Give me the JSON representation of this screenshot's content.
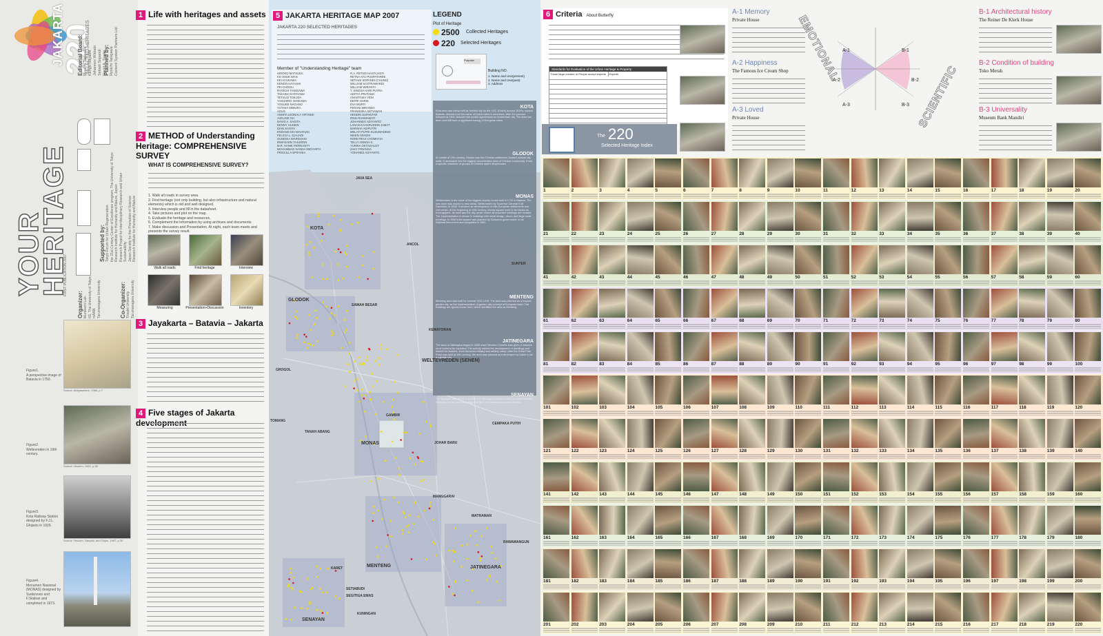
{
  "branding": {
    "jakarta": "JAKARTA",
    "number": "220",
    "selected": "SELECTED HERITAGES",
    "your": "YOUR",
    "heritage": "HERITAGE",
    "first_pub": "FIRST PUBLICATION 2007",
    "editorial_title": "Editorial Board:",
    "editorial_names": [
      "Ryoichi Tanigawa",
      "Kengo Hayashi",
      "Johannes Widodo",
      "Setiadi Sopandi",
      "David A. Sagita"
    ],
    "planned_title": "Planned by:",
    "planned_names": [
      "Ryoichi Tanigawa",
      "Content System Partners Ltd."
    ],
    "supported_title": "Supported by:",
    "supported_lines": [
      "Tokyo Forum for Urban Regeneration",
      "the 21st Century Center of Excellence program, The University of Tokyo",
      "Research Institute for Humanity and Nature, Japan",
      "Research Project for Interdisciplinary Research and Urban Sustainability",
      "Japan Society for the Promotion of Science",
      "Research Institute for Humanity and Nature"
    ],
    "organizer_title": "Organizer:",
    "organizer_lines": [
      "Murakami Lab.",
      "IIS, The University of Tokyo",
      "mAAN",
      "Tarumanagara University"
    ],
    "coorganizer_title": "Co-Organizer:",
    "coorganizer_lines": [
      "Trisakti University",
      "Tarumanagara University"
    ]
  },
  "figures": [
    {
      "label": "Figure1.",
      "caption": "A perspective image of Batavia in 1750.",
      "source": "Source: Abeyasekere, 1989, p.7"
    },
    {
      "label": "Figure2.",
      "caption": "Weltevreden in 19th century.",
      "source": "Source: Heuken, 1982, p.38"
    },
    {
      "label": "Figure3.",
      "caption": "Kota Railway Station designed by F.J.L. Ghijsels in 1929.",
      "source": "Source: Heuken, Haryadi, and Grijns, 1997, p.34"
    },
    {
      "label": "Figure4.",
      "caption": "Monumen Nasional (MONAS) designed by Sudarsono and F.Silaban and completed in 1973.",
      "source": ""
    }
  ],
  "sections": {
    "s1": {
      "num": "1",
      "title": "Life with heritages and assets"
    },
    "s2": {
      "num": "2",
      "title": "METHOD of Understanding Heritage: COMPREHENSIVE SURVEY",
      "subtitle": "WHAT IS COMPREHENSIVE SURVEY?"
    },
    "s3": {
      "num": "3",
      "title": "Jayakarta – Batavia – Jakarta"
    },
    "s4": {
      "num": "4",
      "title": "Five stages of Jakarta development"
    },
    "s5": {
      "num": "5",
      "title": "JAKARTA HERITAGE MAP 2007",
      "subtitle": "JAKARTA 220 SELECTED HERITAGES",
      "members_title": "Member of \"Understanding Heritage\" team"
    },
    "s6": {
      "num": "6",
      "title": "Criteria",
      "subtitle": "About Butterfly"
    }
  },
  "survey_steps": [
    "1. Walk all roads in survey area.",
    "2. Find heritage (not only building, but also infrastructure and natural elements) which is old and well designed.",
    "3. Interview people and fill in the datasheet.",
    "4. Take pictures and plot on the map.",
    "5. Evaluate the heritage and resources.",
    "6. Complement the information by using archives and documents.",
    "7. Make discussion and Presentation. At night, each team meets and presents the survey result."
  ],
  "survey_photos": [
    "Walk all roads",
    "Find heritage",
    "Interview",
    "Measuring",
    "Presentation+Discussion",
    "Inventory"
  ],
  "members_left": [
    "HIROKO MATSUDA",
    "KO SHUK WAN",
    "KEI AYUKAWA",
    "KENGO HAYASHI",
    "PEI CHOOLI",
    "RYOICHI TANIGAWA",
    "TAKASHI KATAYAMA",
    "TETSUJI TOKUDA",
    "YASUHIRO ISHIKAWA",
    "YOSUKE NAGANO",
    "YUTAKA MIMURA",
    "AGUS",
    "ANNITA LEONALY AFFANDI",
    "AVELINE OH",
    "DAVID A. SAGITA",
    "DENNY HUSEIN",
    "DIAN SAGITA",
    "ENDANG EKI WAHYUNI",
    "FELICIA L. DJAJADI",
    "GUNDIKA WARDHANI",
    "IRWAN BIN TAJUDDIN",
    "M.R. HANIK FERRIANTY",
    "MOHAMMAD NANDA WIDYARTA",
    "PRISCILLA EPIFANIA"
  ],
  "members_right": [
    "R.A. RETNO HASTIJANTI",
    "RETNA AYU PUSPATARINI",
    "SETIADI SOPANDI (CHUNG)",
    "WILLIAM SASTRAWARDI",
    "WILLIAM WIRANTA",
    "Y. KINGSA HARI PUTRA",
    "ADITYA PRATAMA",
    "ANASTASIA YENI",
    "DEFRI HARIS",
    "EVA MURTI",
    "FERANI MIRANDA",
    "FRANSISKA SETIAWAN",
    "HENDRI SUPANTAR",
    "IRMA RAHMAWATI",
    "JOHANNES ADIYANTO",
    "LANAN KAHARUDDIN JAMAT",
    "MARSHA ADIPUTRI",
    "MELATI PUTRI KUSUMADEWI",
    "NIKEN ARADHI",
    "RORETRAS CHOMIYAH",
    "TELLY ANNISA K.",
    "YURIKA OKTAVIALDY",
    "ZAKY PRIANGA",
    "YOHANES ADIYANTO"
  ],
  "legend": {
    "title": "LEGEND",
    "plot": "Plot of Heritage",
    "collected_num": "2500",
    "collected_label": "Collected Heritages",
    "selected_num": "220",
    "selected_label": "Selected Heritages",
    "yellow": "#f5d90a",
    "red": "#d7191c",
    "building_no": "Building NO.",
    "building_items": [
      "1. Name and Use(present)",
      "2. Name and Use(past)",
      "3. Address"
    ],
    "label_purpose": "Purpose"
  },
  "map_labels": [
    "JAVA SEA",
    "KOTA",
    "GLODOK",
    "ANCOL",
    "SUNTER",
    "SAWAH BESAR",
    "KEMAYORAN",
    "WELTEVREDEN (SENEN)",
    "MONAS",
    "TANAH ABANG",
    "CEMPAKA PUTIH",
    "TOMANG",
    "JOHAR BARU",
    "GROGOL",
    "MATRAMAN",
    "RAWAMANGUN",
    "MENTENG",
    "KARET",
    "SETIABUDI",
    "SENAYAN",
    "JATINEGARA",
    "SEGITIGA EMAS",
    "KUNINGAN",
    "MANGGARAI",
    "GAMBIR"
  ],
  "districts": [
    {
      "name": "KOTA",
      "text": "Kota area was being built as fortified city by the VOC (Dutch) around 1619's, named Batavia, derived from the name of Dutch nation's ancestors. After the process followed at 1808, Batavia had similar appearance as Amsterdam city. The area has been and still have a significant energy of European cities."
    },
    {
      "name": "GLODOK",
      "text": "At middle of 17th century, Glodok was the Chinese settlement, located outside city walls. It developed into the biggest concentration area of Chinese community. It has a specific character of groups of Chinese style's shophouses."
    },
    {
      "name": "MONAS",
      "text": "Weltevreden is the name of the biggest country house built in 1733 in Batavia. The new town was moved to new areas. Weltevreden by Governor General H.W Daendels, in 1808. It became an development of elite European settlements and civil center. At the beginning of 19th century, Monas square used to be known as Koningsplein. Its area was the city center where all important buildings are located. The implementation is shown in buildings with detail design, decor, and large scale buildings. In 1960's the square was planned by Soekarno government, to be National Monument and completed in 1961."
    },
    {
      "name": "MENTENG",
      "text": "Menteng area was built for several 1910-1918. The area was planned as a tropical garden city, as the implementation of garden city concept of European town. The buildings are typical house form, which identified the area as Menteng."
    },
    {
      "name": "JATINEGARA",
      "text": "The story of Jatinegara began in 1656 when Meester Cornelis was given a massive lot of forest to be exploited. The activity started the development of dwellings and market for workers, soon becomes military and artillery camp. After the Great Post Road was built at 19th century, the area was planned and developed by Dutch to be a satellite city."
    },
    {
      "name": "SENAYAN",
      "text": "The Senayan area which is built for the 4th Asian Games in 1962, is called Stadium Senayan. It was one of the biggest project on Soekarno's government era."
    }
  ],
  "criteria": {
    "table_title": "Standards for Evaluation of the Urban Heritage & Property",
    "col1": "Those large number of People accept experts",
    "col2": "Experts",
    "butterfly_labels": [
      "A-1",
      "A-2",
      "A-3",
      "B-1",
      "B-2",
      "B-3"
    ],
    "emotional": "EMOTIONAL",
    "scientific": "SCIENTIFIC"
  },
  "criteria_items": [
    {
      "code": "A-1 Memory",
      "sub": "Private House",
      "color": "#6d86b5"
    },
    {
      "code": "A-2 Happiness",
      "sub": "The Famous Ice Cream Shop",
      "color": "#6d86b5"
    },
    {
      "code": "A-3 Loved",
      "sub": "Private House",
      "color": "#6d86b5"
    },
    {
      "code": "B-1 Architectural history",
      "sub": "The Reiner De Klerk House",
      "color": "#d9457e"
    },
    {
      "code": "B-2 Condition of building",
      "sub": "Toko Merah",
      "color": "#d9457e"
    },
    {
      "code": "B-3 Universality",
      "sub": "Museum Bank Mandiri",
      "color": "#d9457e"
    }
  ],
  "index": {
    "the": "The",
    "num": "220",
    "label": "Selected Heritage Index"
  },
  "grid_row_starts": [
    1,
    21,
    41,
    61,
    81,
    101,
    121,
    141,
    161,
    181,
    201
  ],
  "grid_row_colors": [
    "#fbf3cf",
    "#e5f1d8",
    "#e6ecd4",
    "#e8dff0",
    "#ece4f3",
    "#fde8d4",
    "#fde6d2",
    "#f0efcf",
    "#e6f0dc",
    "#f4ecd4",
    "#fbf5d6"
  ]
}
